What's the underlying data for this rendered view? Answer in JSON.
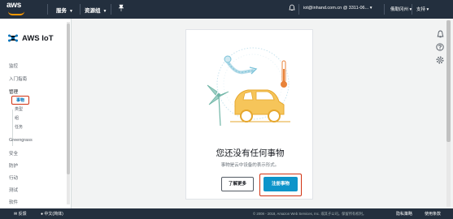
{
  "topbar": {
    "logo_text": "aws",
    "services_label": "服务",
    "resource_groups_label": "资源组",
    "pin_icon": "pin-icon",
    "bell_icon": "bell-icon",
    "account_label": "iot@inhand.com.cn @ 3311-06...",
    "region_label": "俄勒冈州",
    "support_label": "支持"
  },
  "sidebar": {
    "brand": "AWS IoT",
    "items": [
      {
        "label": "监控"
      },
      {
        "label": "入门指南"
      },
      {
        "label": "管理"
      },
      {
        "label": "Greengrass"
      },
      {
        "label": "安全"
      },
      {
        "label": "防护"
      },
      {
        "label": "行动"
      },
      {
        "label": "测试"
      },
      {
        "label": "软件"
      }
    ],
    "manage_sub": [
      {
        "label": "事物"
      },
      {
        "label": "类型"
      },
      {
        "label": "组"
      },
      {
        "label": "任务"
      }
    ]
  },
  "main": {
    "headline": "您还没有任何事物",
    "subtext": "事物是云中设备的表示形式。",
    "learn_more_label": "了解更多",
    "register_label": "注册事物"
  },
  "right_icons": [
    "bell-icon",
    "help-icon",
    "settings-icon"
  ],
  "footer": {
    "feedback_label": "反馈",
    "language_label": "中文(简体)",
    "copyright": "© 2008 - 2018, Amazon Web Services, Inc. 或其子公司。保留所有权利。",
    "privacy_label": "隐私策略",
    "terms_label": "使用条款"
  },
  "colors": {
    "nav_bg": "#232f3e",
    "accent_orange": "#ff9900",
    "primary_button": "#0d94ca",
    "highlight_red": "#d13212"
  }
}
